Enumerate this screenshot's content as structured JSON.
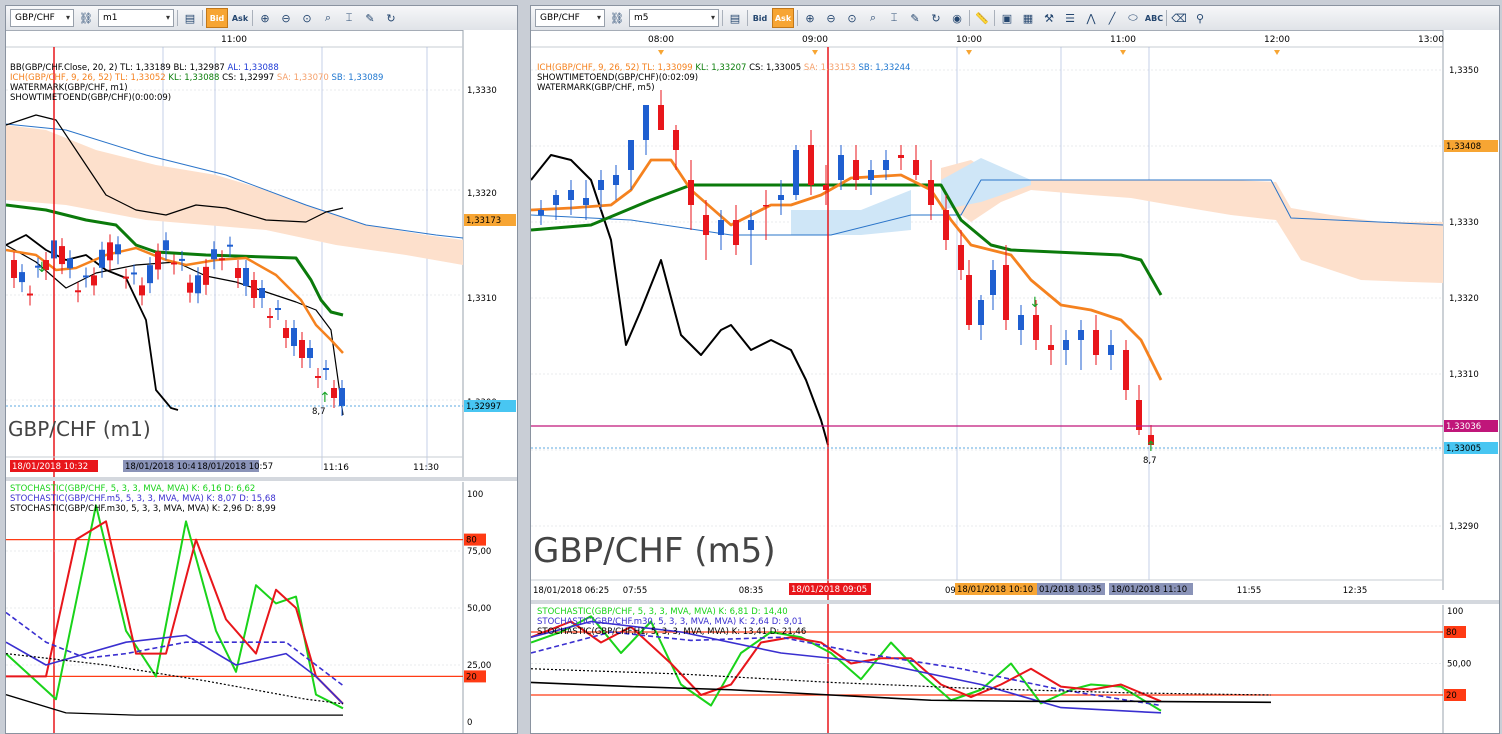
{
  "left": {
    "toolbar": {
      "symbol": "GBP/CHF",
      "period": "m1",
      "bid_label": "Bid",
      "ask_label": "Ask"
    },
    "main": {
      "time_axis": [
        "11:00"
      ],
      "bottom_axis": [
        "11:16",
        "11:30"
      ],
      "red_tag": "18/01/2018 10:32",
      "grey_tag": "18/01/2018 10:49",
      "grey_tag2": "18/01/2018 10:57",
      "price_labels": [
        "1,3330",
        "1,3320",
        "1,3310",
        "1,3300"
      ],
      "tag_orange": "1,33173",
      "tag_blue": "1,32997",
      "legend": [
        {
          "text": "BB(GBP/CHF.Close, 20, 2)  TL: 1,33189  BL: 1,32987  ",
          "color": "#000000"
        },
        {
          "text": "AL: 1,33088",
          "color": "#1f3bd6"
        }
      ],
      "legend2": [
        {
          "text": "ICH(GBP/CHF, 9, 26, 52)  TL: 1,33052  ",
          "color": "#f5821f"
        },
        {
          "text": "KL: 1,33088  ",
          "color": "#0a7d0a"
        },
        {
          "text": "CS: 1,32997  ",
          "color": "#000000"
        },
        {
          "text": "SA: 1,33070  ",
          "color": "#f5a06a"
        },
        {
          "text": "SB: 1,33089",
          "color": "#1f77d0"
        }
      ],
      "legend3": "WATERMARK(GBP/CHF, m1)",
      "legend4": "SHOWTIMETOEND(GBP/CHF)(0:00:09)",
      "watermark": "GBP/CHF (m1)",
      "arrow_label": "8,7"
    },
    "stoch": {
      "legend": [
        {
          "text": "STOCHASTIC(GBP/CHF, 5, 3, 3, MVA, MVA)  K: 6,16  D: 6,62",
          "color": "#1ad31a"
        },
        {
          "text": "STOCHASTIC(GBP/CHF.m5, 5, 3, 3, MVA, MVA)  K: 8,07  D: 15,68",
          "color": "#3a2fd0"
        },
        {
          "text": "STOCHASTIC(GBP/CHF.m30, 5, 3, 3, MVA, MVA)  K: 2,96  D: 8,99",
          "color": "#000000"
        }
      ],
      "levels": [
        "100",
        "80",
        "75,00",
        "50,00",
        "25,00",
        "20",
        "0"
      ]
    }
  },
  "right": {
    "toolbar": {
      "symbol": "GBP/CHF",
      "period": "m5",
      "bid_label": "Bid",
      "ask_label": "Ask"
    },
    "main": {
      "time_axis": [
        "08:00",
        "09:00",
        "10:00",
        "11:00",
        "12:00",
        "13:00"
      ],
      "bottom_axis": [
        "18/01/2018 06:25",
        "07:55",
        "08:35",
        "09",
        "11:55",
        "12:35"
      ],
      "red_tag": "18/01/2018 09:05",
      "orange_tag": "18/01/2018 10:10",
      "grey_tag": "01/2018 10:35",
      "grey_tag2": "18/01/2018 11:10",
      "price_labels": [
        "1,3350",
        "1,3340",
        "1,3330",
        "1,3320",
        "1,3310",
        "1,3300",
        "1,3290"
      ],
      "tag_orange": "1,33408",
      "tag_red": "1,33036",
      "tag_blue": "1,33005",
      "legend1": [
        {
          "text": "ICH(GBP/CHF, 9, 26, 52)  TL: 1,33099  ",
          "color": "#f5821f"
        },
        {
          "text": "KL: 1,33207  ",
          "color": "#0a7d0a"
        },
        {
          "text": "CS: 1,33005  ",
          "color": "#000000"
        },
        {
          "text": "SA: 1,33153  ",
          "color": "#f5a06a"
        },
        {
          "text": "SB: 1,33244",
          "color": "#1f77d0"
        }
      ],
      "legend2": "SHOWTIMETOEND(GBP/CHF)(0:02:09)",
      "legend3": "WATERMARK(GBP/CHF, m5)",
      "watermark": "GBP/CHF (m5)",
      "arrow_label": "8,7"
    },
    "stoch": {
      "legend": [
        {
          "text": "STOCHASTIC(GBP/CHF, 5, 3, 3, MVA, MVA)  K: 6,81  D: 14,40",
          "color": "#1ad31a"
        },
        {
          "text": "STOCHASTIC(GBP/CHF.m30, 5, 3, 3, MVA, MVA)  K: 2,64  D: 9,01",
          "color": "#3a2fd0"
        },
        {
          "text": "STOCHASTIC(GBP/CHF.H1, 5, 3, 3, MVA, MVA)  K: 13,41  D: 21,46",
          "color": "#000000"
        }
      ],
      "levels": [
        "100",
        "80",
        "50,00",
        "20"
      ]
    }
  },
  "colors": {
    "bull": "#1f5fd0",
    "bear": "#e8161b",
    "kijun": "#0b7a0b",
    "tenkan": "#f5821f",
    "cloud": "#fde0cc",
    "cloud_blue": "#cfe6f7"
  }
}
